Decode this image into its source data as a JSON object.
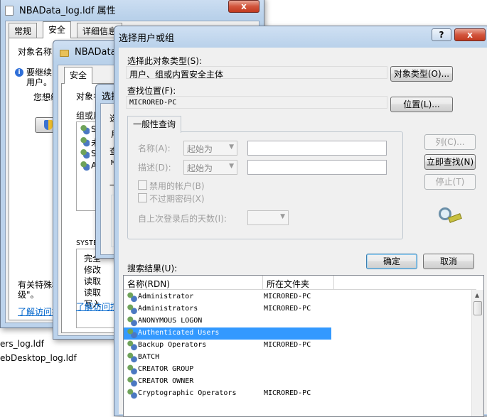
{
  "desktop": {
    "file1": "ers_log.ldf",
    "file2": "ebDesktop_log.ldf"
  },
  "win1": {
    "title": "NBAData_log.ldf 属性",
    "tabs": [
      "常规",
      "安全",
      "详细信息"
    ],
    "obj_name_label": "对象名称:",
    "info_line1": "要继续",
    "info_line2": "用户。",
    "want_line": "您想继",
    "special_line1": "有关特殊权",
    "special_line2": "级\"。",
    "link": "了解访问控"
  },
  "win2": {
    "title": "NBAData",
    "tab": "安全",
    "obj_label": "对象名",
    "group_label": "组或用",
    "users_partial": [
      "S",
      "未",
      "S",
      "A"
    ],
    "system_label": "SYSTEM",
    "perms": [
      "完全",
      "修改",
      "读取",
      "读取",
      "写入"
    ],
    "link": "了解访问控"
  },
  "win3": {
    "title": "选择",
    "partial": [
      "选",
      "用",
      "查",
      "M",
      "一",
      "​"
    ]
  },
  "dialog": {
    "title": "选择用户或组",
    "help": "?",
    "close": "x",
    "object_type_label": "选择此对象类型(S):",
    "object_type_value": "用户、组或内置安全主体",
    "object_type_button": "对象类型(O)...",
    "location_label": "查找位置(F):",
    "location_value": "MICRORED-PC",
    "location_button": "位置(L)...",
    "tab_general": "一般性查询",
    "name_label": "名称(A):",
    "name_combo": "起始为",
    "desc_label": "描述(D):",
    "desc_combo": "起始为",
    "chk_disabled": "禁用的帐户(B)",
    "chk_noexpire": "不过期密码(X)",
    "days_label": "自上次登录后的天数(I):",
    "btn_columns": "列(C)...",
    "btn_find_now": "立即查找(N)",
    "btn_stop": "停止(T)",
    "btn_ok": "确定",
    "btn_cancel": "取消",
    "results_label": "搜索结果(U):",
    "col_name": "名称(RDN)",
    "col_folder": "所在文件夹",
    "rows": [
      {
        "name": "Administrator",
        "folder": "MICRORED-PC"
      },
      {
        "name": "Administrators",
        "folder": "MICRORED-PC"
      },
      {
        "name": "ANONYMOUS LOGON",
        "folder": ""
      },
      {
        "name": "Authenticated Users",
        "folder": ""
      },
      {
        "name": "Backup Operators",
        "folder": "MICRORED-PC"
      },
      {
        "name": "BATCH",
        "folder": ""
      },
      {
        "name": "CREATOR GROUP",
        "folder": ""
      },
      {
        "name": "CREATOR OWNER",
        "folder": ""
      },
      {
        "name": "Cryptographic Operators",
        "folder": "MICRORED-PC"
      }
    ]
  }
}
